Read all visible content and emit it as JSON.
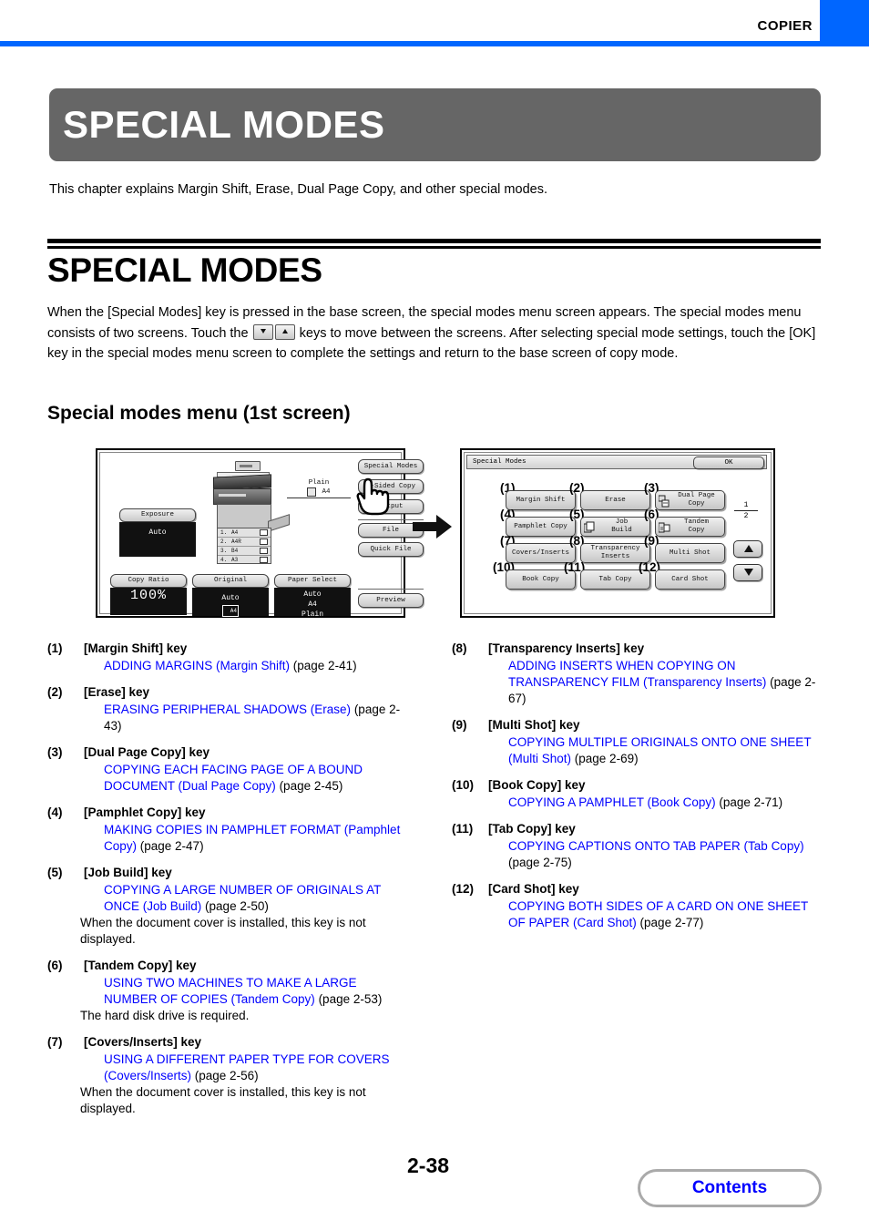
{
  "header": {
    "mode_label": "COPIER",
    "accent_color": "#0066ff"
  },
  "chapter": {
    "banner_title": "SPECIAL MODES",
    "intro": "This chapter explains Margin Shift, Erase, Dual Page Copy, and other special modes."
  },
  "section": {
    "h1": "SPECIAL MODES",
    "body_part1": "When the [Special Modes] key is pressed in the base screen, the special modes menu screen appears. The special modes menu consists of two screens. Touch the ",
    "body_part2": " keys to move between the screens. After selecting special mode settings, touch the [OK] key in the special modes menu screen to complete the settings and return to the base screen of copy mode.",
    "h2": "Special modes menu (1st screen)"
  },
  "base_screen": {
    "exposure_label": "Exposure",
    "exposure_value": "Auto",
    "copy_ratio_label": "Copy Ratio",
    "copy_ratio_value": "100%",
    "original_label": "Original",
    "original_value": "Auto",
    "original_icon_text": "A4",
    "paper_select_label": "Paper Select",
    "paper_select_value1": "Auto",
    "paper_select_value2": "A4",
    "paper_select_value3": "Plain",
    "side_keys": [
      "Special Modes",
      "2-Sided Copy",
      "Output",
      "File",
      "Quick File",
      "Preview"
    ],
    "paper_info_type": "Plain",
    "paper_info_size": "A4",
    "trays": [
      {
        "num": "1.",
        "size": "A4"
      },
      {
        "num": "2.",
        "size": "A4R"
      },
      {
        "num": "3.",
        "size": "B4"
      },
      {
        "num": "4.",
        "size": "A3"
      }
    ]
  },
  "special_modes_screen": {
    "title": "Special Modes",
    "ok_label": "OK",
    "page_current": "1",
    "page_total": "2",
    "buttons": [
      {
        "callout": "(1)",
        "label": "Margin Shift",
        "icon": "none"
      },
      {
        "callout": "(2)",
        "label": "Erase",
        "icon": "none"
      },
      {
        "callout": "(3)",
        "label": "Dual Page\nCopy",
        "icon": "dual-page-icon"
      },
      {
        "callout": "(4)",
        "label": "Pamphlet Copy",
        "icon": "none"
      },
      {
        "callout": "(5)",
        "label": "Job\nBuild",
        "icon": "job-build-icon"
      },
      {
        "callout": "(6)",
        "label": "Tandem\nCopy",
        "icon": "tandem-copy-icon"
      },
      {
        "callout": "(7)",
        "label": "Covers/Inserts",
        "icon": "none"
      },
      {
        "callout": "(8)",
        "label": "Transparency\nInserts",
        "icon": "none"
      },
      {
        "callout": "(9)",
        "label": "Multi Shot",
        "icon": "none"
      },
      {
        "callout": "(10)",
        "label": "Book Copy",
        "icon": "none"
      },
      {
        "callout": "(11)",
        "label": "Tab Copy",
        "icon": "none"
      },
      {
        "callout": "(12)",
        "label": "Card Shot",
        "icon": "none"
      }
    ]
  },
  "reference_list_left": [
    {
      "num": "(1)",
      "key": "[Margin Shift] key",
      "link": "ADDING MARGINS (Margin Shift)",
      "page": " (page 2-41)",
      "note": ""
    },
    {
      "num": "(2)",
      "key": "[Erase] key",
      "link": "ERASING PERIPHERAL SHADOWS (Erase)",
      "page": " (page 2-43)",
      "note": ""
    },
    {
      "num": "(3)",
      "key": "[Dual Page Copy] key",
      "link": "COPYING EACH FACING PAGE OF A BOUND DOCUMENT (Dual Page Copy)",
      "page": " (page 2-45)",
      "note": ""
    },
    {
      "num": "(4)",
      "key": "[Pamphlet Copy] key",
      "link": "MAKING COPIES IN PAMPHLET FORMAT (Pamphlet Copy)",
      "page": " (page 2-47)",
      "note": ""
    },
    {
      "num": "(5)",
      "key": "[Job Build] key",
      "link": "COPYING A LARGE NUMBER OF ORIGINALS AT ONCE (Job Build)",
      "page": " (page 2-50)",
      "note": "When the document cover is installed, this key is not displayed."
    },
    {
      "num": "(6)",
      "key": "[Tandem Copy] key",
      "link": "USING TWO MACHINES TO MAKE A LARGE NUMBER OF COPIES (Tandem Copy)",
      "page": " (page 2-53)",
      "note": "The hard disk drive is required."
    },
    {
      "num": "(7)",
      "key": "[Covers/Inserts] key",
      "link": "USING A DIFFERENT PAPER TYPE FOR COVERS (Covers/Inserts)",
      "page": " (page 2-56)",
      "note": "When the document cover is installed, this key is not displayed."
    }
  ],
  "reference_list_right": [
    {
      "num": "(8)",
      "key": "[Transparency Inserts] key",
      "link": "ADDING INSERTS WHEN COPYING ON TRANSPARENCY FILM (Transparency Inserts)",
      "page": " (page 2-67)",
      "note": ""
    },
    {
      "num": "(9)",
      "key": "[Multi Shot] key",
      "link": "COPYING MULTIPLE ORIGINALS ONTO ONE SHEET (Multi Shot)",
      "page": " (page 2-69)",
      "note": ""
    },
    {
      "num": "(10)",
      "key": "[Book Copy] key",
      "link": "COPYING A PAMPHLET (Book Copy)",
      "page": " (page 2-71)",
      "note": ""
    },
    {
      "num": "(11)",
      "key": "[Tab Copy] key",
      "link": "COPYING CAPTIONS ONTO TAB PAPER (Tab Copy)",
      "page": " (page 2-75)",
      "note": ""
    },
    {
      "num": "(12)",
      "key": "[Card Shot] key",
      "link": "COPYING BOTH SIDES OF A CARD ON ONE SHEET OF PAPER (Card Shot)",
      "page": " (page 2-77)",
      "note": ""
    }
  ],
  "footer": {
    "page_number": "2-38",
    "contents_label": "Contents"
  }
}
